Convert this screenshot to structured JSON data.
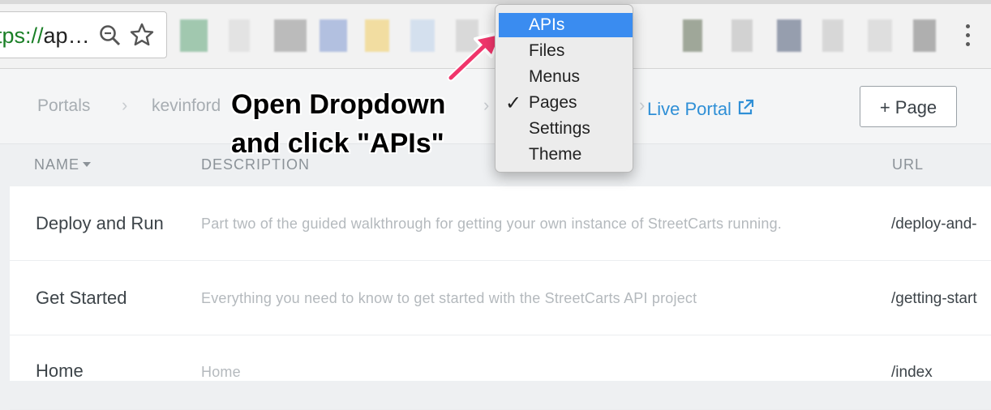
{
  "browser": {
    "url_scheme": "tps://",
    "url_rest": "ap…",
    "icons": [
      "zoom-icon",
      "star-icon",
      "menu-icon"
    ],
    "extension_colors": [
      "#5fa77a",
      "#d8d8d8",
      "#8f8f8f",
      "#7f98d2",
      "#f2cd60",
      "#bdd3ec",
      "#c6c6c6",
      "#b5b5b5",
      "#5d6b52",
      "#b8b8b8",
      "#4c5a78",
      "#c2c2c2",
      "#cfcfcf",
      "#7a7a7a"
    ]
  },
  "breadcrumb": {
    "items": [
      "Portals",
      "kevinford"
    ],
    "live_portal": "Live Portal"
  },
  "header": {
    "add_page_label": "+ Page"
  },
  "dropdown": {
    "items": [
      {
        "label": "APIs",
        "selected": false,
        "highlighted": true
      },
      {
        "label": "Files",
        "selected": false,
        "highlighted": false
      },
      {
        "label": "Menus",
        "selected": false,
        "highlighted": false
      },
      {
        "label": "Pages",
        "selected": true,
        "highlighted": false
      },
      {
        "label": "Settings",
        "selected": false,
        "highlighted": false
      },
      {
        "label": "Theme",
        "selected": false,
        "highlighted": false
      }
    ],
    "check_glyph": "✓"
  },
  "annotation": {
    "line1": "Open Dropdown",
    "line2": "and click \"APIs\"",
    "arrow_color": "#f0356b"
  },
  "table": {
    "columns": {
      "name": "NAME",
      "description": "DESCRIPTION",
      "url": "URL"
    },
    "rows": [
      {
        "name": "Deploy and Run",
        "description": "Part two of the guided walkthrough for getting your own instance of StreetCarts running.",
        "url": "/deploy-and-"
      },
      {
        "name": "Get Started",
        "description": "Everything you need to know to get started with the StreetCarts API project",
        "url": "/getting-start"
      },
      {
        "name": "Home",
        "description": "Home",
        "url": "/index"
      }
    ]
  },
  "colors": {
    "accent": "#3a8cf0",
    "link": "#2f8fd6"
  }
}
